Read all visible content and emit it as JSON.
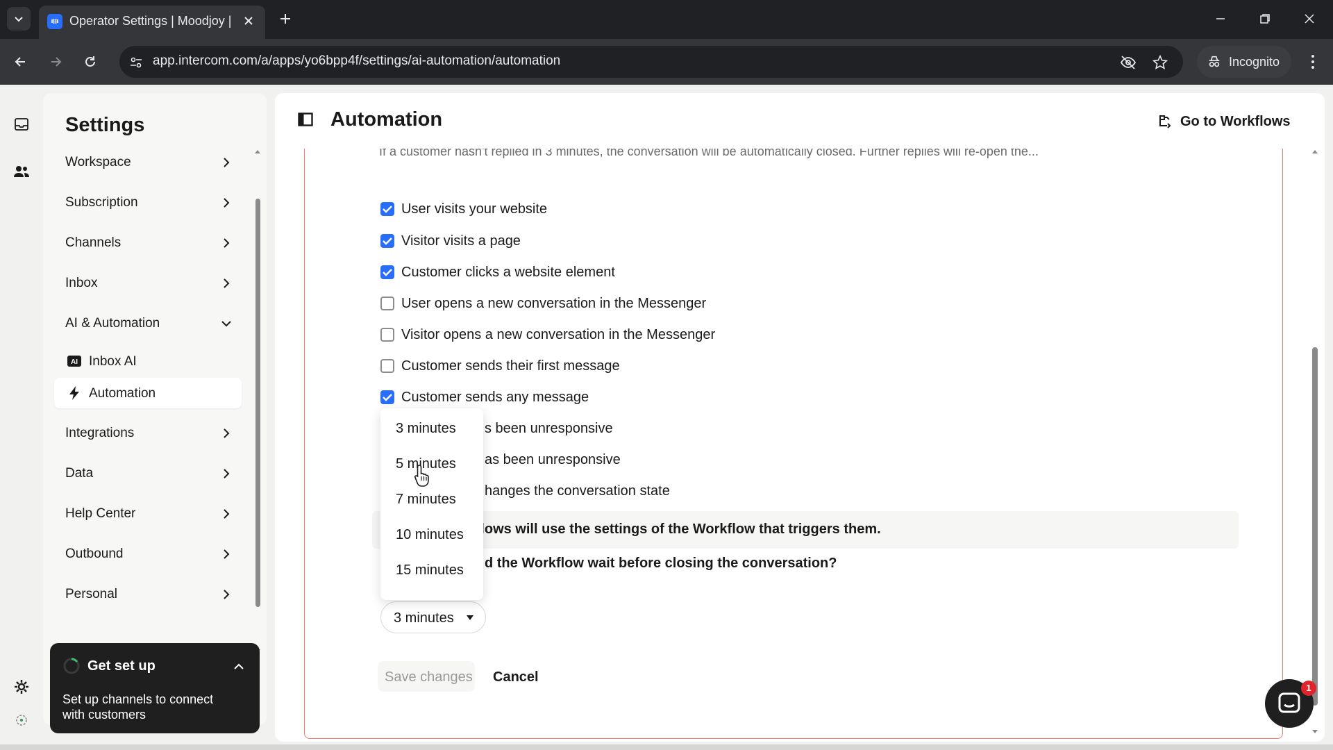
{
  "browser": {
    "tab_title": "Operator Settings | Moodjoy | I",
    "url": "app.intercom.com/a/apps/yo6bpp4f/settings/ai-automation/automation",
    "incognito_label": "Incognito"
  },
  "settings_nav": {
    "title": "Settings",
    "items": [
      {
        "label": "Workspace"
      },
      {
        "label": "Subscription"
      },
      {
        "label": "Channels"
      },
      {
        "label": "Inbox"
      },
      {
        "label": "AI & Automation"
      },
      {
        "label": "Integrations"
      },
      {
        "label": "Data"
      },
      {
        "label": "Help Center"
      },
      {
        "label": "Outbound"
      },
      {
        "label": "Personal"
      }
    ],
    "sub_items": [
      {
        "label": "Inbox AI",
        "icon": "ai-badge-icon"
      },
      {
        "label": "Automation",
        "icon": "lightning-icon"
      }
    ]
  },
  "get_set_up": {
    "title": "Get set up",
    "text": "Set up channels to connect with customers"
  },
  "header": {
    "title": "Automation",
    "go_to_workflows": "Go to Workflows"
  },
  "content": {
    "cut_text": "If a customer hasn't replied in 3 minutes, the conversation will be automatically closed. Further replies will re-open the...",
    "triggers": [
      {
        "label": "User visits your website",
        "checked": true
      },
      {
        "label": "Visitor visits a page",
        "checked": true
      },
      {
        "label": "Customer clicks a website element",
        "checked": true
      },
      {
        "label": "User opens a new conversation in the Messenger",
        "checked": false
      },
      {
        "label": "Visitor opens a new conversation in the Messenger",
        "checked": false
      },
      {
        "label": "Customer sends their first message",
        "checked": false
      },
      {
        "label": "Customer sends any message",
        "checked": true
      },
      {
        "label": "s been unresponsive",
        "checked": false
      },
      {
        "label": "as been unresponsive",
        "checked": false
      },
      {
        "label": "hanges the conversation state",
        "checked": false
      }
    ],
    "info_text": "Workflows will use the settings of the Workflow that triggers them.",
    "question": "d the Workflow wait before closing the conversation?",
    "selected_wait": "3 minutes",
    "save_label": "Save changes",
    "cancel_label": "Cancel"
  },
  "dropdown": {
    "options": [
      "3 minutes",
      "5 minutes",
      "7 minutes",
      "10 minutes",
      "15 minutes"
    ],
    "hovered": "5 minutes"
  },
  "messenger": {
    "badge": "1"
  },
  "colors": {
    "accent": "#286efa",
    "card_border": "#f47b67",
    "dark": "#1f1f1f"
  }
}
